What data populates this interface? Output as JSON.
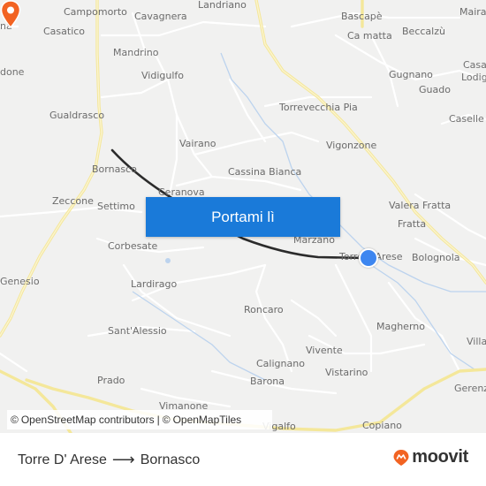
{
  "map": {
    "places": [
      {
        "name": "Landriano",
        "slot": "p-landriano"
      },
      {
        "name": "Campomorto",
        "slot": "p-campomorto"
      },
      {
        "name": "Cavagnera",
        "slot": "p-cavagnera"
      },
      {
        "name": "Bascapè",
        "slot": "p-bascape"
      },
      {
        "name": "Maira",
        "slot": "p-maira"
      },
      {
        "name": "na",
        "slot": "p-na"
      },
      {
        "name": "Casatico",
        "slot": "p-casatico"
      },
      {
        "name": "Ca matta",
        "slot": "p-camatta"
      },
      {
        "name": "Beccalzù",
        "slot": "p-beccalzu"
      },
      {
        "name": "Mandrino",
        "slot": "p-mandrino"
      },
      {
        "name": "Casal",
        "slot": "p-casal"
      },
      {
        "name": "Lodig",
        "slot": "p-lodig"
      },
      {
        "name": "done",
        "slot": "p-done"
      },
      {
        "name": "Vidigulfo",
        "slot": "p-vidigulfo"
      },
      {
        "name": "Gugnano",
        "slot": "p-gugnano"
      },
      {
        "name": "Guado",
        "slot": "p-guado"
      },
      {
        "name": "Torrevecchia Pia",
        "slot": "p-torrevecchia"
      },
      {
        "name": "Gualdrasco",
        "slot": "p-gualdrasco"
      },
      {
        "name": "Caselle L",
        "slot": "p-caselle"
      },
      {
        "name": "Vairano",
        "slot": "p-vairano"
      },
      {
        "name": "Vigonzone",
        "slot": "p-vigonzone"
      },
      {
        "name": "Cassina Bianca",
        "slot": "p-cassina"
      },
      {
        "name": "Ceranova",
        "slot": "p-ceranova"
      },
      {
        "name": "Zeccone",
        "slot": "p-zeccone"
      },
      {
        "name": "Settimo",
        "slot": "p-settimo"
      },
      {
        "name": "Valera Fratta",
        "slot": "p-valera"
      },
      {
        "name": "Fratta",
        "slot": "p-fratta"
      },
      {
        "name": "Marzano",
        "slot": "p-marzano"
      },
      {
        "name": "Corbesate",
        "slot": "p-corbesate"
      },
      {
        "name": "Bolognola",
        "slot": "p-bolognola"
      },
      {
        "name": "Genesio",
        "slot": "p-genesio"
      },
      {
        "name": "Lardirago",
        "slot": "p-lardirago"
      },
      {
        "name": "Roncaro",
        "slot": "p-roncaro"
      },
      {
        "name": "Sant'Alessio",
        "slot": "p-santalessio"
      },
      {
        "name": "Magherno",
        "slot": "p-magherno"
      },
      {
        "name": "Villa",
        "slot": "p-villa"
      },
      {
        "name": "Vivente",
        "slot": "p-vivente"
      },
      {
        "name": "Calignano",
        "slot": "p-calignano"
      },
      {
        "name": "Vistarino",
        "slot": "p-vistarino"
      },
      {
        "name": "Prado",
        "slot": "p-prado"
      },
      {
        "name": "Barona",
        "slot": "p-barona"
      },
      {
        "name": "Gerenz",
        "slot": "p-gerenz"
      },
      {
        "name": "Vimanone",
        "slot": "p-vimanone"
      },
      {
        "name": "Vigalfo",
        "slot": "p-vigalfo"
      },
      {
        "name": "Copiano",
        "slot": "p-copiano"
      },
      {
        "name": "Bornasco",
        "slot": "p-bornasco-map"
      },
      {
        "name": "Torre d'Arese",
        "slot": "p-torredarese-map"
      }
    ],
    "origin_marker_color": "#f26322",
    "destination_marker_color": "#3d86f0",
    "route_color": "#2b2b2b"
  },
  "cta": {
    "label": "Portami lì",
    "color": "#1a7ad9"
  },
  "attribution": {
    "copy1": "©",
    "osm": "OpenStreetMap contributors",
    "sep": "|",
    "copy2": "©",
    "omt": "OpenMapTiles"
  },
  "footer": {
    "from": "Torre D' Arese",
    "arrow": "⟶",
    "to": "Bornasco",
    "brand": "moovit",
    "brand_color": "#f26322"
  }
}
